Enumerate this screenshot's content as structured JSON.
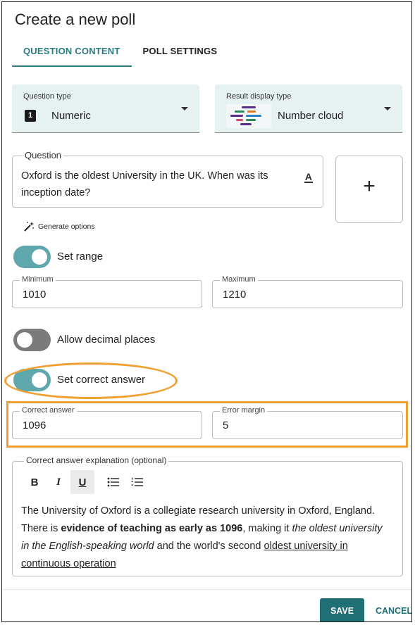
{
  "dialog": {
    "title": "Create a new poll"
  },
  "tabs": [
    {
      "label": "QUESTION CONTENT",
      "active": true
    },
    {
      "label": "POLL SETTINGS",
      "active": false
    }
  ],
  "question_type": {
    "label": "Question type",
    "value": "Numeric",
    "icon_glyph": "1"
  },
  "result_display": {
    "label": "Result display type",
    "value": "Number cloud",
    "icon": "number-cloud-icon"
  },
  "question": {
    "label": "Question",
    "text": "Oxford is the oldest University in the UK. When was its inception date?",
    "format_icon": "A"
  },
  "add_media": {
    "glyph": "+"
  },
  "generate": {
    "label": "Generate options",
    "icon": "magic-wand-icon"
  },
  "set_range": {
    "label": "Set range",
    "on": true
  },
  "minimum": {
    "label": "Minimum",
    "value": "1010"
  },
  "maximum": {
    "label": "Maximum",
    "value": "1210"
  },
  "allow_decimal": {
    "label": "Allow decimal places",
    "on": false
  },
  "set_correct": {
    "label": "Set correct answer",
    "on": true
  },
  "correct_answer": {
    "label": "Correct answer",
    "value": "1096"
  },
  "error_margin": {
    "label": "Error margin",
    "value": "5"
  },
  "explanation": {
    "label": "Correct answer explanation (optional)",
    "toolbar": {
      "bold": "B",
      "italic": "I",
      "underline": "U"
    },
    "p1": "The University of Oxford is a collegiate research university in Oxford, England. There is ",
    "bold": "evidence of teaching as early as 1096",
    "p2": ", making it ",
    "italic": "the oldest university in the English-speaking world",
    "p3": " and the world's second ",
    "underline": "oldest university in continuous operation"
  },
  "actions": {
    "save": "SAVE",
    "cancel": "CANCEL"
  },
  "colors": {
    "accent": "#1f6f74",
    "toggle_on": "#5ea8ad",
    "highlight": "#f0a030",
    "select_bg": "#e6f2f2"
  }
}
